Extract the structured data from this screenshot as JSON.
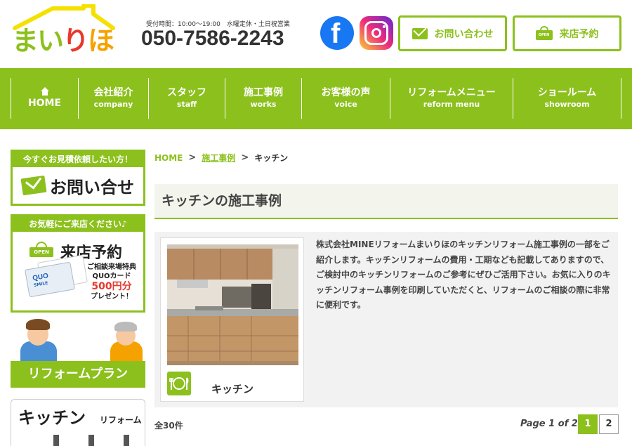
{
  "header": {
    "logo_text": "まいりほ",
    "hours": "受付時間：10:00〜19:00　水曜定休・土日祝営業",
    "phone": "050-7586-2243",
    "contact_button": "お問い合わせ",
    "reserve_button": "来店予約"
  },
  "nav": {
    "items": [
      {
        "ja": "",
        "en": "HOME"
      },
      {
        "ja": "会社紹介",
        "en": "company"
      },
      {
        "ja": "スタッフ",
        "en": "staff"
      },
      {
        "ja": "施工事例",
        "en": "works"
      },
      {
        "ja": "お客様の声",
        "en": "voice"
      },
      {
        "ja": "リフォームメニュー",
        "en": "reform menu"
      },
      {
        "ja": "ショールーム",
        "en": "showroom"
      }
    ]
  },
  "sidebar": {
    "contact_band": "今すぐお見積依頼したい方！",
    "contact_text": "お問い合せ",
    "reserve_band": "お気軽にご来店ください♪",
    "reserve_title": "来店予約",
    "open_badge": "OPEN",
    "quo_brand": "QUO",
    "quo_sub": "SMILE",
    "quo_line1": "ご相談来場特典",
    "quo_line2": "QUOカード",
    "quo_price": "500円分",
    "quo_line3": "プレゼント！",
    "plan_label": "リフォームプラン",
    "kitchen_big": "キッチン",
    "kitchen_small": "リフォーム"
  },
  "breadcrumb": {
    "home": "HOME",
    "works": "施工事例",
    "current": "キッチン",
    "separator": ">"
  },
  "main": {
    "title": "キッチンの施工事例",
    "card_label": "キッチン",
    "description": "株式会社MINEリフォームまいりほのキッチンリフォーム施工事例の一部をご紹介します。キッチンリフォームの費用・工期なども記載してありますので、ご検討中のキッチンリフォームのご参考にぜひご活用下さい。お気に入りのキッチンリフォーム事例を印刷していただくと、リフォームのご相談の際に非常に便利です。",
    "total": "全30件",
    "page_info": "Page 1 of 2",
    "pages": [
      "1",
      "2"
    ]
  },
  "colors": {
    "accent": "#8cc01d",
    "logo_roof": "#f5e100",
    "logo_red": "#e8372c",
    "logo_orange": "#f5a200"
  }
}
